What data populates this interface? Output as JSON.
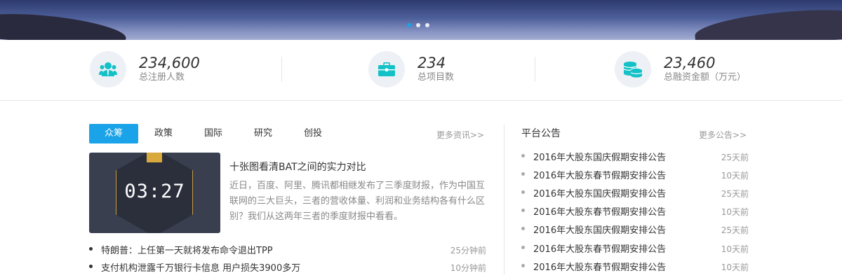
{
  "banner": {
    "slides": 3,
    "active_slide": 0
  },
  "stats": [
    {
      "value": "234,600",
      "label": "总注册人数",
      "icon": "users-icon"
    },
    {
      "value": "234",
      "label": "总项目数",
      "icon": "briefcase-icon"
    },
    {
      "value": "23,460",
      "label": "总融资金额（万元）",
      "icon": "coins-icon"
    }
  ],
  "colors": {
    "accent": "#1aa3e8",
    "icon": "#14c1c7"
  },
  "news": {
    "tabs": [
      "众筹",
      "政策",
      "国际",
      "研究",
      "创投"
    ],
    "active_tab": 0,
    "more": "更多资讯>>",
    "featured": {
      "title": "十张图看清BAT之间的实力对比",
      "desc": "近日，百度、阿里、腾讯都相继发布了三季度财报，作为中国互联网的三大巨头，三者的营收体量、利润和业务结构各有什么区别？我们从这两年三者的季度财报中看看。",
      "image_time": "03:27"
    },
    "items": [
      {
        "title": "特朗普：上任第一天就将发布命令退出TPP",
        "time": "25分钟前"
      },
      {
        "title": "支付机构泄露千万银行卡信息 用户损失3900多万",
        "time": "10分钟前"
      }
    ]
  },
  "announcements": {
    "title": "平台公告",
    "more": "更多公告>>",
    "items": [
      {
        "title": "2016年大股东国庆假期安排公告",
        "time": "25天前"
      },
      {
        "title": "2016年大股东春节假期安排公告",
        "time": "10天前"
      },
      {
        "title": "2016年大股东国庆假期安排公告",
        "time": "25天前"
      },
      {
        "title": "2016年大股东春节假期安排公告",
        "time": "10天前"
      },
      {
        "title": "2016年大股东国庆假期安排公告",
        "time": "25天前"
      },
      {
        "title": "2016年大股东春节假期安排公告",
        "time": "10天前"
      },
      {
        "title": "2016年大股东春节假期安排公告",
        "time": "10天前"
      }
    ]
  }
}
